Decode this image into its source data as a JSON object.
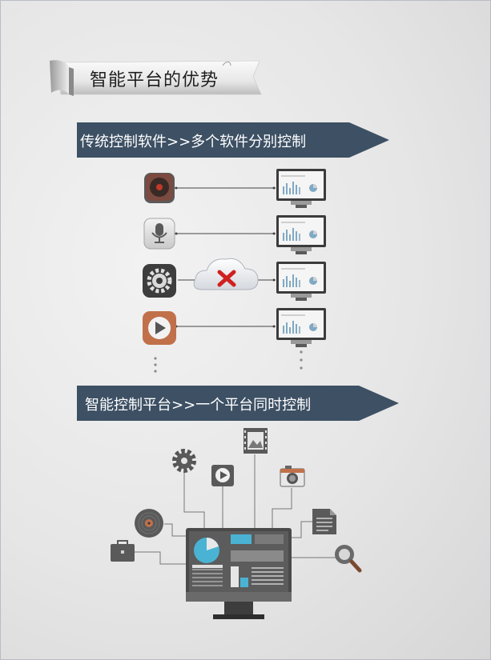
{
  "title": "智能平台的优势",
  "section1": {
    "label": "传统控制软件>>多个软件分别控制"
  },
  "section2": {
    "label": "智能控制平台>>一个平台同时控制"
  },
  "icons": {
    "row1": "vinyl-record-icon",
    "row2": "microphone-icon",
    "row3": "gear-icon",
    "row4": "play-icon",
    "cloud": "cloud-error-icon",
    "monitor": "monitor-dashboard-icon"
  },
  "colors": {
    "banner": "#3d5064",
    "monitor_bezel": "#4a4a4a",
    "accent_blue": "#4ab3d3",
    "error_red": "#d02020"
  }
}
